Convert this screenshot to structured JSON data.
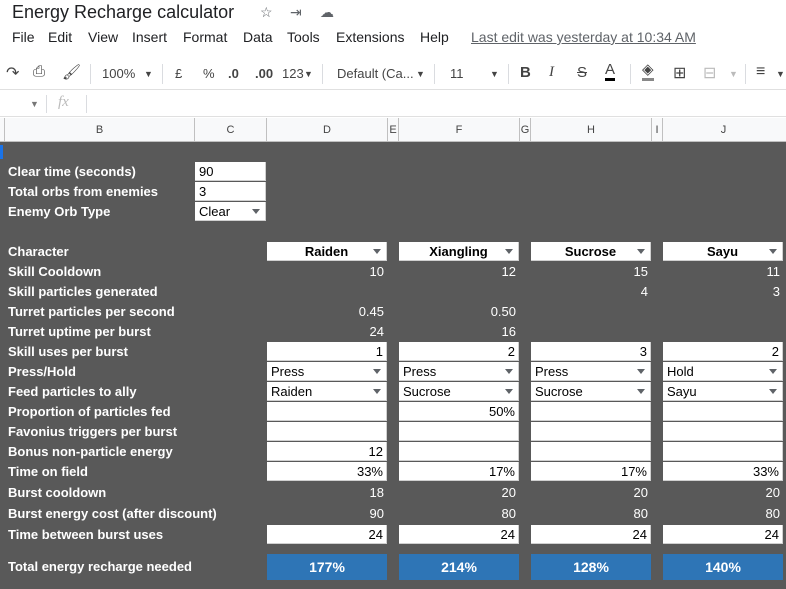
{
  "doc": {
    "title": "Energy Recharge calculator",
    "last_edit": "Last edit was yesterday at 10:34 AM"
  },
  "menu": [
    "File",
    "Edit",
    "View",
    "Insert",
    "Format",
    "Data",
    "Tools",
    "Extensions",
    "Help"
  ],
  "toolbar": {
    "zoom": "100%",
    "currency": "£",
    "percent": "%",
    "dec_less": ".0",
    "dec_more": ".00",
    "format": "123",
    "font": "Default (Ca...",
    "font_size": "11",
    "bold": "B",
    "italic": "I",
    "strike": "S",
    "text_color": "A"
  },
  "formula": {
    "fx": "fx"
  },
  "columns": [
    "B",
    "C",
    "D",
    "E",
    "F",
    "G",
    "H",
    "I",
    "J"
  ],
  "inputs": {
    "clear_time_label": "Clear time (seconds)",
    "clear_time": "90",
    "orbs_label": "Total orbs from enemies",
    "orbs": "3",
    "orb_type_label": "Enemy Orb Type",
    "orb_type": "Clear"
  },
  "row_labels": {
    "character": "Character",
    "skill_cd": "Skill Cooldown",
    "skill_particles": "Skill particles generated",
    "turret_pps": "Turret particles per second",
    "turret_uptime": "Turret uptime per burst",
    "skill_uses": "Skill uses per burst",
    "press_hold": "Press/Hold",
    "feed": "Feed particles to ally",
    "proportion": "Proportion of particles fed",
    "favonius": "Favonius triggers per burst",
    "bonus": "Bonus non-particle energy",
    "time_on_field": "Time on field",
    "burst_cd": "Burst cooldown",
    "burst_cost": "Burst energy cost (after discount)",
    "time_between": "Time between burst uses",
    "total_er": "Total energy recharge needed"
  },
  "characters": [
    {
      "name": "Raiden",
      "skill_cd": "10",
      "skill_particles": "",
      "turret_pps": "0.45",
      "turret_uptime": "24",
      "skill_uses": "1",
      "press_hold": "Press",
      "feed": "Raiden",
      "proportion": "",
      "favonius": "",
      "bonus": "12",
      "time_on_field": "33%",
      "burst_cd": "18",
      "burst_cost": "90",
      "time_between": "24",
      "total_er": "177%"
    },
    {
      "name": "Xiangling",
      "skill_cd": "12",
      "skill_particles": "",
      "turret_pps": "0.50",
      "turret_uptime": "16",
      "skill_uses": "2",
      "press_hold": "Press",
      "feed": "Sucrose",
      "proportion": "50%",
      "favonius": "",
      "bonus": "",
      "time_on_field": "17%",
      "burst_cd": "20",
      "burst_cost": "80",
      "time_between": "24",
      "total_er": "214%"
    },
    {
      "name": "Sucrose",
      "skill_cd": "15",
      "skill_particles": "4",
      "turret_pps": "",
      "turret_uptime": "",
      "skill_uses": "3",
      "press_hold": "Press",
      "feed": "Sucrose",
      "proportion": "",
      "favonius": "",
      "bonus": "",
      "time_on_field": "17%",
      "burst_cd": "20",
      "burst_cost": "80",
      "time_between": "24",
      "total_er": "128%"
    },
    {
      "name": "Sayu",
      "skill_cd": "11",
      "skill_particles": "3",
      "turret_pps": "",
      "turret_uptime": "",
      "skill_uses": "2",
      "press_hold": "Hold",
      "feed": "Sayu",
      "proportion": "",
      "favonius": "",
      "bonus": "",
      "time_on_field": "33%",
      "burst_cd": "20",
      "burst_cost": "80",
      "time_between": "24",
      "total_er": "140%"
    }
  ]
}
